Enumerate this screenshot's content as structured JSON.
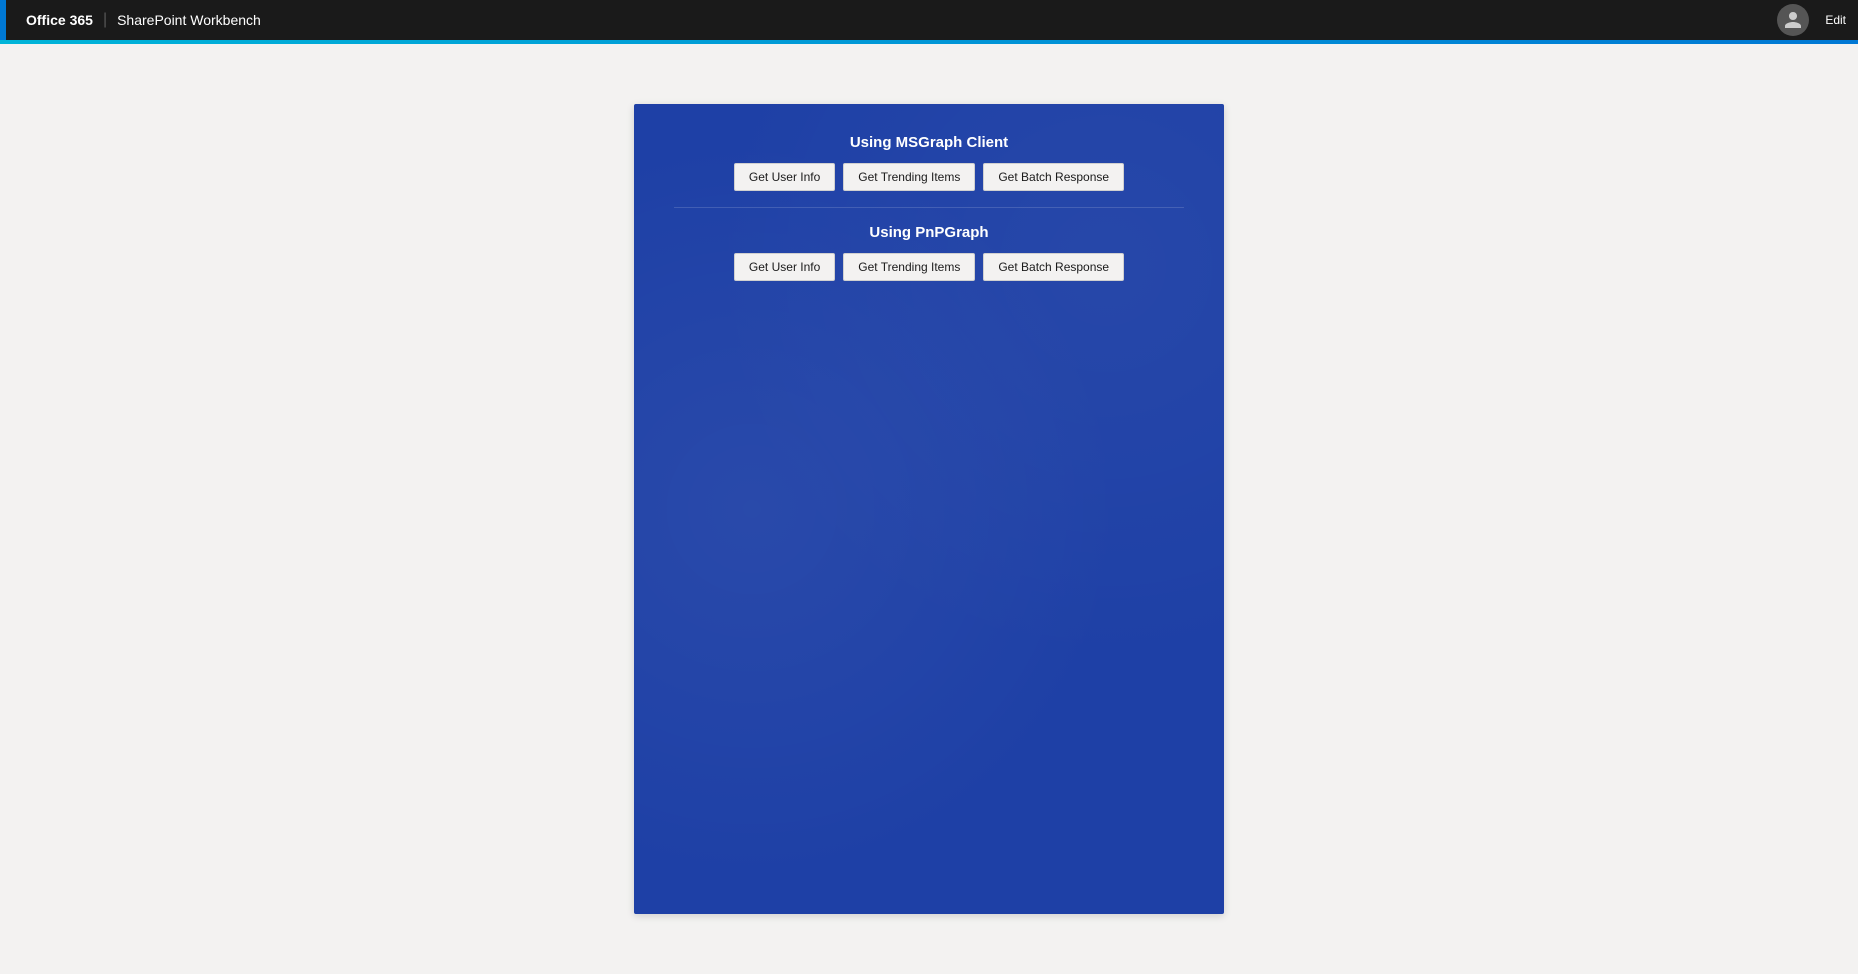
{
  "header": {
    "brand": "Office 365",
    "divider": "|",
    "title": "SharePoint Workbench",
    "edit_label": "Edit"
  },
  "msgraph_section": {
    "title": "Using MSGraph Client",
    "buttons": [
      {
        "label": "Get User Info",
        "id": "msgraph-user-info"
      },
      {
        "label": "Get Trending Items",
        "id": "msgraph-trending"
      },
      {
        "label": "Get Batch Response",
        "id": "msgraph-batch"
      }
    ]
  },
  "pnpgraph_section": {
    "title": "Using PnPGraph",
    "buttons": [
      {
        "label": "Get User Info",
        "id": "pnp-user-info"
      },
      {
        "label": "Get Trending Items",
        "id": "pnp-trending"
      },
      {
        "label": "Get Batch Response",
        "id": "pnp-batch"
      }
    ]
  }
}
